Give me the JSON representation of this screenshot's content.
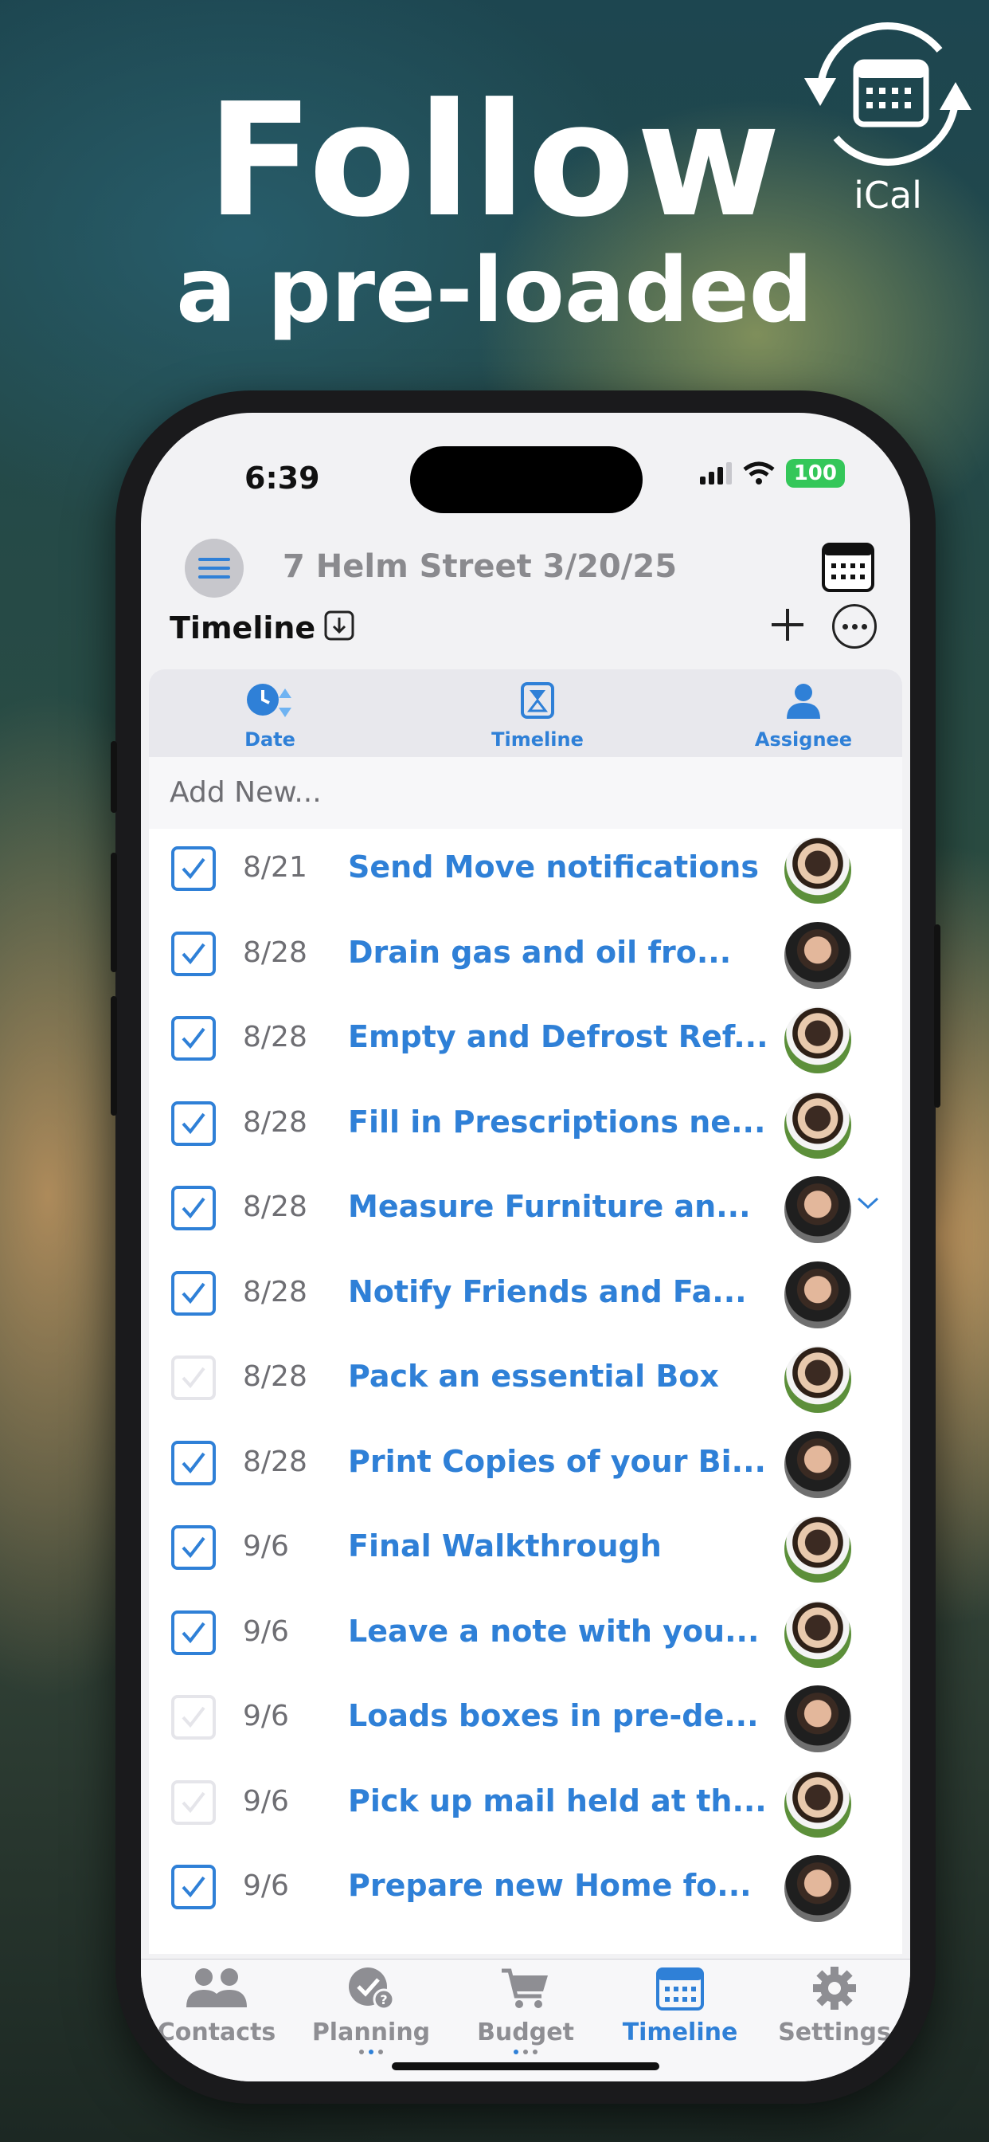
{
  "promo": {
    "headline": "Follow",
    "subheadline": "a pre-loaded",
    "badge_label": "iCal"
  },
  "status_bar": {
    "time": "6:39",
    "battery": "100"
  },
  "header": {
    "title": "7 Helm Street 3/20/25"
  },
  "subheader": {
    "title": "Timeline"
  },
  "segments": [
    {
      "label": "Date",
      "icon": "clock-sort-icon"
    },
    {
      "label": "Timeline",
      "icon": "hourglass-icon"
    },
    {
      "label": "Assignee",
      "icon": "person-icon"
    }
  ],
  "add_new_placeholder": "Add New...",
  "tasks": [
    {
      "date": "8/21",
      "title": "Send Move notifications",
      "done": true,
      "assignee": "female"
    },
    {
      "date": "8/28",
      "title": "Drain gas and oil fro...",
      "done": true,
      "assignee": "male"
    },
    {
      "date": "8/28",
      "title": "Empty and Defrost Ref...",
      "done": true,
      "assignee": "female"
    },
    {
      "date": "8/28",
      "title": "Fill in Prescriptions ne...",
      "done": true,
      "assignee": "female"
    },
    {
      "date": "8/28",
      "title": "Measure Furniture an...",
      "done": true,
      "assignee": "male"
    },
    {
      "date": "8/28",
      "title": "Notify Friends and Fa...",
      "done": true,
      "assignee": "male"
    },
    {
      "date": "8/28",
      "title": "Pack an essential Box",
      "done": false,
      "assignee": "female"
    },
    {
      "date": "8/28",
      "title": "Print Copies of your Bi...",
      "done": true,
      "assignee": "male"
    },
    {
      "date": "9/6",
      "title": "Final Walkthrough",
      "done": true,
      "assignee": "female"
    },
    {
      "date": "9/6",
      "title": "Leave a note with you...",
      "done": true,
      "assignee": "female"
    },
    {
      "date": "9/6",
      "title": "Loads boxes in pre-de...",
      "done": false,
      "assignee": "male"
    },
    {
      "date": "9/6",
      "title": "Pick up mail held at th...",
      "done": false,
      "assignee": "female"
    },
    {
      "date": "9/6",
      "title": "Prepare new Home fo...",
      "done": true,
      "assignee": "male"
    }
  ],
  "tabbar": [
    {
      "label": "Contacts",
      "icon": "contacts-icon",
      "active": false
    },
    {
      "label": "Planning",
      "icon": "planning-icon",
      "active": false
    },
    {
      "label": "Budget",
      "icon": "cart-icon",
      "active": false
    },
    {
      "label": "Timeline",
      "icon": "calendar-icon",
      "active": true
    },
    {
      "label": "Settings",
      "icon": "gear-icon",
      "active": false
    }
  ],
  "colors": {
    "accent": "#2f80d7",
    "muted": "#8e8e93",
    "battery": "#34c759"
  }
}
